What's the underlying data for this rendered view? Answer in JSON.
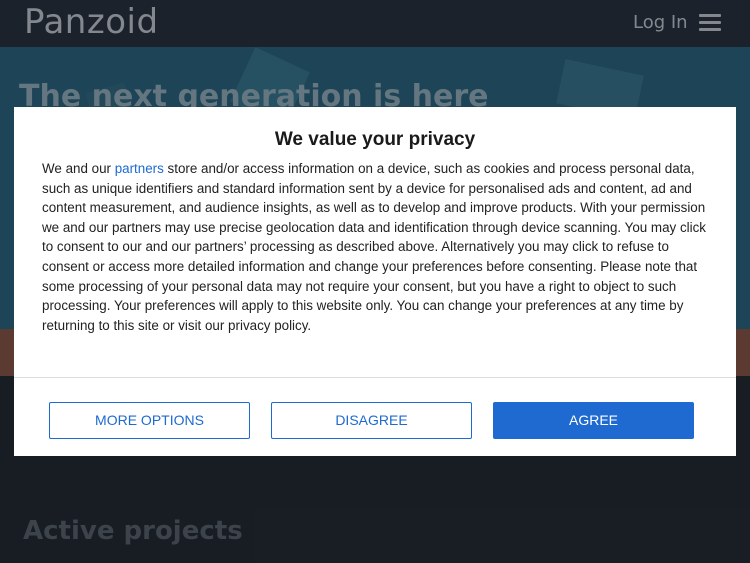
{
  "site": {
    "logo": "Panzoid",
    "login_label": "Log In",
    "hero_title": "The next generation is here",
    "section_title": "Active projects"
  },
  "consent": {
    "title": "We value your privacy",
    "body_prefix": "We and our ",
    "partners_link": "partners",
    "body_text": " store and/or access information on a device, such as cookies and process personal data, such as unique identifiers and standard information sent by a device for personalised ads and content, ad and content measurement, and audience insights, as well as to develop and improve products. With your permission we and our partners may use precise geolocation data and identification through device scanning. You may click to consent to our and our partners’ processing as described above. Alternatively you may click to refuse to consent or access more detailed information and change your preferences before consenting. Please note that some processing of your personal data may not require your consent, but you have a right to object to such processing. Your preferences will apply to this website only. You can change your preferences at any time by returning to this site or visit our privacy policy.",
    "buttons": {
      "more_options": "MORE OPTIONS",
      "disagree": "DISAGREE",
      "agree": "AGREE"
    }
  },
  "colors": {
    "accent": "#1e6ad0",
    "topbar": "#2b3542",
    "hero": "#2d6a86"
  }
}
